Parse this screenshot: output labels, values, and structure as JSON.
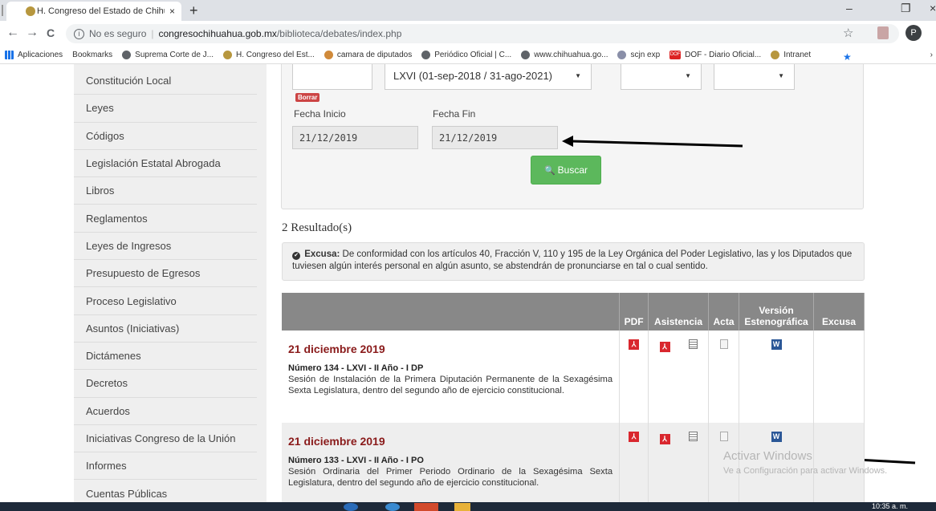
{
  "browser": {
    "tab_title": "H. Congreso del Estado de Chihu",
    "tab_close": "×",
    "new_tab": "+",
    "win_min": "–",
    "win_max": "❐",
    "win_close": "×",
    "back": "←",
    "forward": "→",
    "reload": "C",
    "info": "i",
    "insecure_label": "No es seguro",
    "divider": "|",
    "url_host": "congresochihuahua.gob.mx",
    "url_path": "/biblioteca/debates/index.php",
    "star": "☆",
    "profile_initial": "P"
  },
  "bookmarks": [
    {
      "label": "Aplicaciones",
      "icon": "apps-icon"
    },
    {
      "label": "Bookmarks",
      "icon": "star-icon"
    },
    {
      "label": "Suprema Corte de J...",
      "icon": "globe-icon"
    },
    {
      "label": "H. Congreso del Est...",
      "icon": "congreso-icon"
    },
    {
      "label": "camara de diputados",
      "icon": "camara-icon"
    },
    {
      "label": "Periódico Oficial | C...",
      "icon": "globe-icon"
    },
    {
      "label": "www.chihuahua.go...",
      "icon": "globe-icon"
    },
    {
      "label": "scjn exp",
      "icon": "scjn-icon"
    },
    {
      "label": "DOF - Diario Oficial...",
      "icon": "dof-icon"
    },
    {
      "label": "Intranet",
      "icon": "congreso-icon"
    }
  ],
  "bookmark_dof_badge": "DOF",
  "bookmark_more": "›",
  "sidebar": {
    "items": [
      "Constitución Local",
      "Leyes",
      "Códigos",
      "Legislación Estatal Abrogada",
      "Libros",
      "Reglamentos",
      "Leyes de Ingresos",
      "Presupuesto de Egresos",
      "Proceso Legislativo",
      "Asuntos (Iniciativas)",
      "Dictámenes",
      "Decretos",
      "Acuerdos",
      "Iniciativas Congreso de la Unión",
      "Informes",
      "Cuentas Públicas"
    ]
  },
  "form": {
    "legislatura_value": "LXVI (01-sep-2018 / 31-ago-2021)",
    "caret": "▼",
    "borrar_label": "Borrar",
    "fecha_inicio_label": "Fecha Inicio",
    "fecha_fin_label": "Fecha Fin",
    "fecha_inicio_value": "21/12/2019",
    "fecha_fin_value": "21/12/2019",
    "buscar_icon": "🔍",
    "buscar_label": "Buscar"
  },
  "results": {
    "title": "2 Resultado(s)",
    "excusa_check": "✔",
    "excusa_label": "Excusa:",
    "excusa_text": " De conformidad con los artículos 40, Fracción V, 110 y 195 de la Ley Orgánica del Poder Legislativo, las y los Diputados que tuviesen algún interés personal en algún asunto, se abstendrán de pronunciarse en tal o cual sentido.",
    "columns": [
      "",
      "PDF",
      "Asistencia",
      "Acta",
      "Versión Estenográfica",
      "Excusa"
    ],
    "rows": [
      {
        "date": "21 diciembre 2019",
        "numero": "Número 134 - LXVI - II Año - I DP",
        "descripcion": "Sesión de Instalación de la Primera Diputación Permanente de la Sexagésima Sexta Legislatura, dentro del segundo año de ejercicio constitucional."
      },
      {
        "date": "21 diciembre 2019",
        "numero": "Número 133 - LXVI - II Año - I PO",
        "descripcion": "Sesión Ordinaria del Primer Periodo Ordinario de la Sexagésima Sexta Legislatura, dentro del segundo año de ejercicio constitucional."
      }
    ],
    "pdf_glyph": "⅄",
    "word_glyph": "W"
  },
  "watermark": {
    "line1": "Activar Windows",
    "line2": "Ve a Configuración para activar Windows."
  },
  "taskbar": {
    "clock": "10:35 a. m."
  },
  "annotation_color": "#000000"
}
